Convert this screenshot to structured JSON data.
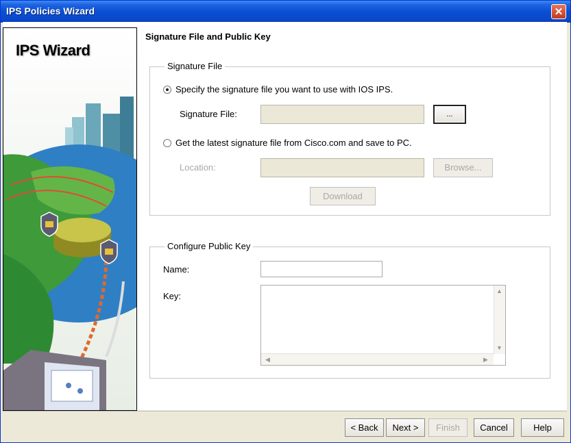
{
  "window": {
    "title": "IPS Policies Wizard",
    "close_glyph": "✕"
  },
  "side_panel": {
    "title": "IPS Wizard"
  },
  "page": {
    "heading": "Signature File and Public Key"
  },
  "signature_file": {
    "legend": "Signature File",
    "option_specify": {
      "label": "Specify the signature file you want to use with IOS IPS.",
      "selected": true
    },
    "signature_file_label": "Signature File:",
    "signature_file_value": "",
    "browse_dots_label": "...",
    "option_download": {
      "label": "Get the latest signature file from Cisco.com and save to PC.",
      "selected": false
    },
    "location_label": "Location:",
    "location_value": "",
    "browse_label": "Browse...",
    "download_label": "Download"
  },
  "public_key": {
    "legend": "Configure Public Key",
    "name_label": "Name:",
    "name_value": "",
    "key_label": "Key:",
    "key_value": ""
  },
  "footer": {
    "back_label": "< Back",
    "next_label": "Next >",
    "finish_label": "Finish",
    "cancel_label": "Cancel",
    "help_label": "Help"
  },
  "colors": {
    "title_bar": "#0a4fd6",
    "window_face": "#ece9d8",
    "disabled_text": "#a8a8a8"
  }
}
